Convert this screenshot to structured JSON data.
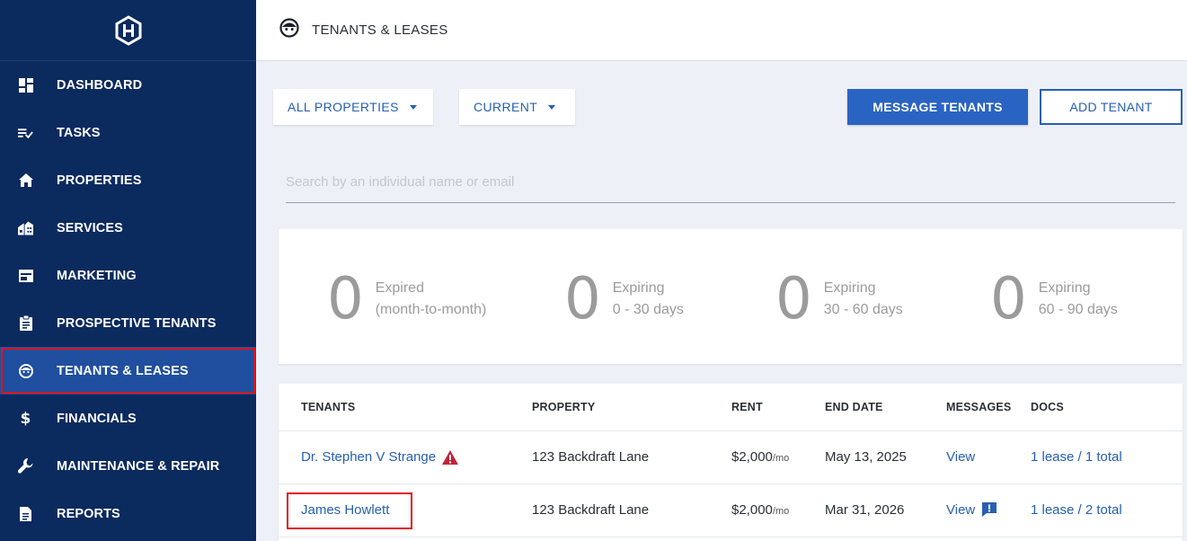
{
  "sidebar": {
    "logo": "house-hex-logo",
    "items": [
      {
        "label": "DASHBOARD",
        "icon": "dashboard-icon"
      },
      {
        "label": "TASKS",
        "icon": "tasks-icon"
      },
      {
        "label": "PROPERTIES",
        "icon": "home-icon"
      },
      {
        "label": "SERVICES",
        "icon": "services-icon"
      },
      {
        "label": "MARKETING",
        "icon": "marketing-icon"
      },
      {
        "label": "PROSPECTIVE TENANTS",
        "icon": "clipboard-icon"
      },
      {
        "label": "TENANTS & LEASES",
        "icon": "face-icon",
        "active": true
      },
      {
        "label": "FINANCIALS",
        "icon": "dollar-icon"
      },
      {
        "label": "MAINTENANCE & REPAIR",
        "icon": "wrench-icon"
      },
      {
        "label": "REPORTS",
        "icon": "report-icon"
      }
    ]
  },
  "header": {
    "title": "TENANTS & LEASES",
    "icon": "face-icon"
  },
  "filters": {
    "properties": "ALL PROPERTIES",
    "status": "CURRENT"
  },
  "actions": {
    "message": "MESSAGE TENANTS",
    "add": "ADD TENANT"
  },
  "search": {
    "placeholder": "Search by an individual name or email"
  },
  "stats": [
    {
      "count": "0",
      "line1": "Expired",
      "line2": "(month-to-month)"
    },
    {
      "count": "0",
      "line1": "Expiring",
      "line2": "0 - 30 days"
    },
    {
      "count": "0",
      "line1": "Expiring",
      "line2": "30 - 60 days"
    },
    {
      "count": "0",
      "line1": "Expiring",
      "line2": "60 - 90 days"
    }
  ],
  "table": {
    "columns": [
      "TENANTS",
      "PROPERTY",
      "RENT",
      "END DATE",
      "MESSAGES",
      "DOCS"
    ],
    "rows": [
      {
        "tenant": "Dr. Stephen V Strange",
        "warning": true,
        "property": "123 Backdraft Lane",
        "rent": "$2,000",
        "rent_unit": "/mo",
        "end_date": "May 13, 2025",
        "messages": "View",
        "unread": false,
        "docs": "1 lease / 1 total"
      },
      {
        "tenant": "James Howlett",
        "warning": false,
        "property": "123 Backdraft Lane",
        "rent": "$2,000",
        "rent_unit": "/mo",
        "end_date": "Mar 31, 2026",
        "messages": "View",
        "unread": true,
        "docs": "1 lease / 2 total"
      }
    ]
  },
  "colors": {
    "sidebar": "#0b2a5e",
    "active": "#1f4f9e",
    "accent": "#2a64c2",
    "highlight": "#e0131c"
  }
}
